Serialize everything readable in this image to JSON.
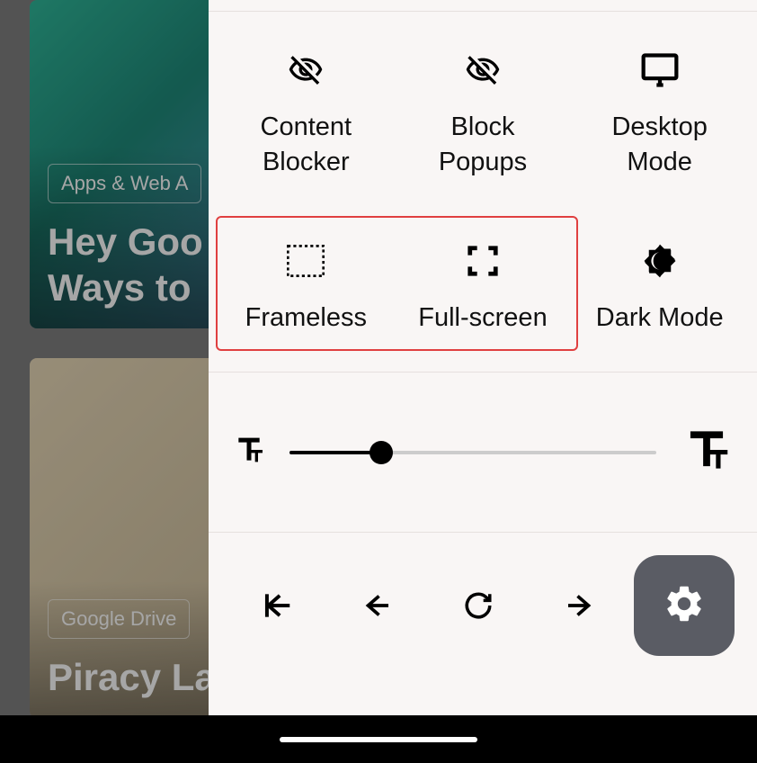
{
  "background": {
    "card1": {
      "tag": "Apps & Web A",
      "headline": "Hey Goo<br>Ways to "
    },
    "card2": {
      "tag": "Google Drive",
      "headline": "Piracy La"
    }
  },
  "options": [
    {
      "id": "content-blocker",
      "label": "Content\nBlocker",
      "icon": "eye-off"
    },
    {
      "id": "block-popups",
      "label": "Block\nPopups",
      "icon": "eye-off"
    },
    {
      "id": "desktop-mode",
      "label": "Desktop\nMode",
      "icon": "monitor"
    },
    {
      "id": "frameless",
      "label": "Frameless",
      "icon": "frameless"
    },
    {
      "id": "full-screen",
      "label": "Full-screen",
      "icon": "fullscreen"
    },
    {
      "id": "dark-mode",
      "label": "Dark Mode",
      "icon": "dark-mode"
    }
  ],
  "highlighted_option_ids": [
    "frameless",
    "full-screen"
  ],
  "text_size": {
    "value_percent": 25
  },
  "nav": {
    "home": "home",
    "back": "back",
    "reload": "reload",
    "forward": "forward",
    "settings": "settings"
  }
}
